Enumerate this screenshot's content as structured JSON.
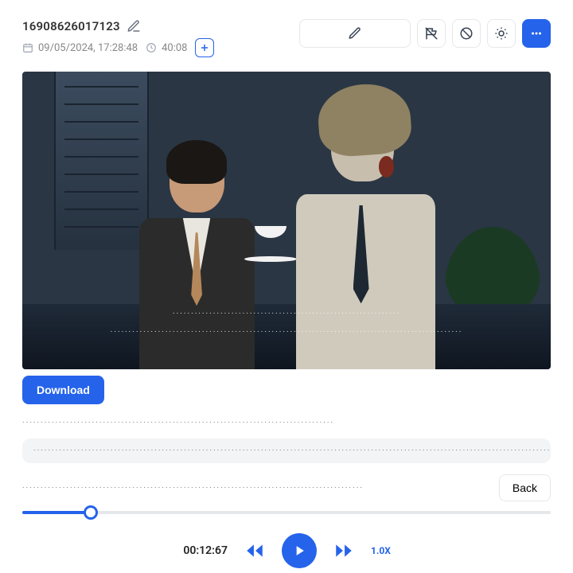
{
  "title": "16908626017123",
  "meta": {
    "date": "09/05/2024, 17:28:48",
    "duration": "40:08"
  },
  "toolbar": {
    "download_label": "Download",
    "back_label": "Back"
  },
  "overlay": {
    "dots_a": "······························································",
    "dots_b": "································································································"
  },
  "lines": {
    "line1": "·····················································································",
    "pill": "··················································································································································",
    "line3": "·····························································································"
  },
  "player": {
    "time": "00:12:67",
    "speed": "1.0X",
    "progress_percent": 13
  },
  "colors": {
    "primary": "#2563eb"
  }
}
